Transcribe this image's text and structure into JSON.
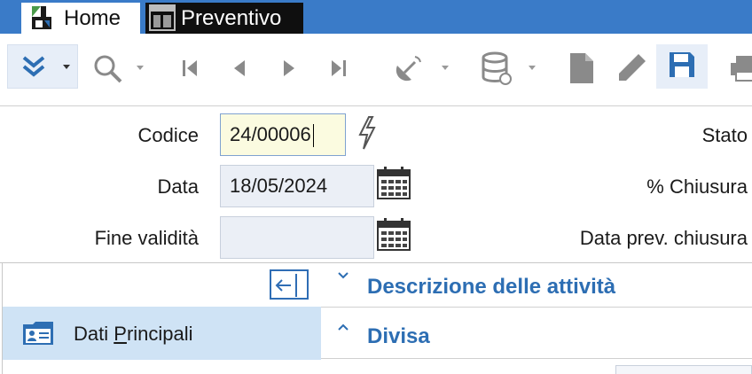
{
  "tabs": {
    "home": "Home",
    "preventivo": "Preventivo"
  },
  "toolbar": {
    "icons": [
      "double-chevron-down-icon",
      "search-icon",
      "first-record-icon",
      "previous-record-icon",
      "next-record-icon",
      "last-record-icon",
      "satellite-icon",
      "database-icon",
      "new-document-icon",
      "edit-icon",
      "save-icon",
      "print-icon"
    ]
  },
  "form": {
    "codice_label": "Codice",
    "codice_value": "24/00006",
    "data_label": "Data",
    "data_value": "18/05/2024",
    "fine_validita_label": "Fine validità",
    "fine_validita_value": "",
    "stato_label": "Stato",
    "chiusura_label": "% Chiusura",
    "data_prev_chiusura_label": "Data prev. chiusura"
  },
  "sidebar": {
    "dati_principali_pre": "Dati ",
    "dati_principali_accel": "P",
    "dati_principali_post": "rincipali"
  },
  "sections": {
    "descrizione": "Descrizione delle attività",
    "divisa": "Divisa"
  },
  "colors": {
    "tab_bar": "#3a7bc8",
    "accent": "#2d6eb3",
    "selected_bg": "#cfe3f5",
    "input_bg": "#ebeff6",
    "active_input_bg": "#fbfbe0"
  }
}
